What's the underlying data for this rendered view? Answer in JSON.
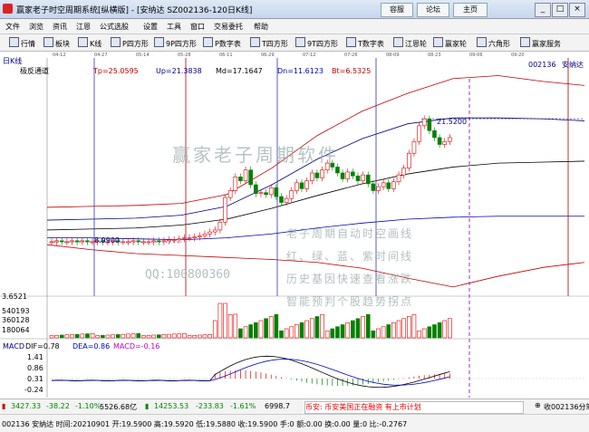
{
  "window": {
    "title": "赢家老子时空周期系统[纵横版] - [安纳达  SZ002136-120日K线]",
    "buttons": [
      "容服",
      "论坛",
      "主页"
    ]
  },
  "menu": [
    "文件",
    "浏览",
    "资讯",
    "江恩",
    "公式选股",
    "设置",
    "工具",
    "窗口",
    "交易委托",
    "帮助"
  ],
  "toolbar": [
    "行情",
    "板块",
    "K线",
    "P四方形",
    "9P四方形",
    "P数字表",
    "T四方形",
    "9T四方形",
    "T数字表",
    "江恩轮",
    "赢家轮",
    "六角形",
    "赢家服务"
  ],
  "chart": {
    "period": "日K线",
    "indicator": "极反通道",
    "params": [
      {
        "label": "Tp=25.0595",
        "color": "#c00000"
      },
      {
        "label": "Up=21.3838",
        "color": "#000080"
      },
      {
        "label": "Md=17.1647",
        "color": "#000000"
      },
      {
        "label": "Dn=11.6123",
        "color": "#0000c0"
      },
      {
        "label": "Bt=6.5325",
        "color": "#c00000"
      }
    ],
    "code": "002136",
    "name": "安纳达",
    "date_ticks": [
      "04-12",
      "04-27",
      "05-14",
      "05-28",
      "06-11",
      "06-29",
      "07-12",
      "07-26",
      "08-09",
      "08-23",
      "09-06",
      "09-20"
    ],
    "price_label_high": "21.5200",
    "price_label_low": "8.9900",
    "price_axis_label": "3.6521",
    "watermark_main": "赢家老子周期软件",
    "watermark_qq": "QQ:100800360",
    "watermark_lines": [
      "老子周期自动时空画线",
      "红、绿、蓝、紫时间线",
      "历史基因快速查看涨跌",
      "智能预判个股趋势拐点"
    ],
    "volume_labels": [
      "540193",
      "360128",
      "180064"
    ],
    "macd_title": "MACD",
    "macd_values": [
      {
        "label": "DIF=0.78",
        "color": "#000000"
      },
      {
        "label": "DEA=0.86",
        "color": "#0000c0"
      },
      {
        "label": "MACD=-0.16",
        "color": "#c000c0"
      }
    ],
    "macd_ticks": [
      "1.41",
      "0.86",
      "0.31",
      "-0.24"
    ]
  },
  "status": {
    "sh_value": "3427.33",
    "sh_change": "-38.22",
    "sh_pct": "-1.10%",
    "sh_amount": "5526.68亿",
    "sz_value": "14253.53",
    "sz_change": "-233.83",
    "sz_pct": "-1.61%",
    "sz_amount": "6998.7",
    "ticker": "币安: 币安美国正在融资 有上市计划",
    "receive": "收002136分笔",
    "quote_line": "002136 安纳达 时间:20210901 开:19.5900 高:19.5920 低:19.5880 收:19.5900 手:0 额:0.00 换:0.00 量:0 比:-0.2767"
  },
  "chart_data": {
    "type": "candlestick",
    "x": [
      "04-12",
      "04-27",
      "05-14",
      "05-28",
      "06-11",
      "06-29",
      "07-12",
      "07-26",
      "08-09",
      "08-23"
    ],
    "series": [
      {
        "name": "Tp",
        "values": [
          null,
          null,
          null,
          null,
          null,
          null,
          null,
          null,
          null,
          25.0595
        ]
      },
      {
        "name": "Up",
        "values": [
          null,
          null,
          null,
          null,
          null,
          null,
          null,
          null,
          null,
          21.3838
        ]
      },
      {
        "name": "Md",
        "values": [
          null,
          null,
          null,
          null,
          null,
          null,
          null,
          null,
          null,
          17.1647
        ]
      },
      {
        "name": "Dn",
        "values": [
          null,
          null,
          null,
          null,
          null,
          null,
          null,
          null,
          null,
          11.6123
        ]
      },
      {
        "name": "Bt",
        "values": [
          null,
          null,
          null,
          null,
          null,
          null,
          null,
          null,
          null,
          6.5325
        ]
      }
    ],
    "annotations": [
      "21.5200",
      "8.9900"
    ],
    "volume_axis": [
      180064,
      360128,
      540193
    ],
    "macd_axis": [
      -0.24,
      0.31,
      0.86,
      1.41
    ]
  }
}
